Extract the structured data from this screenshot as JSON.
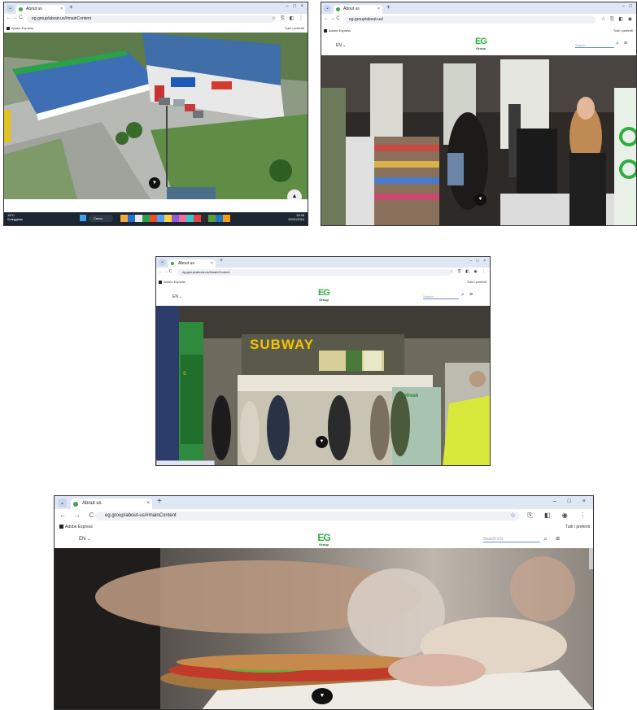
{
  "screenshots": [
    {
      "tab_title": "About us",
      "url": "eg.group/about-us/#mainContent",
      "bookmark": "Adobe Express",
      "bookmarks_right": "Tutti i preferiti"
    },
    {
      "tab_title": "About us",
      "url": "eg.group/about-us/",
      "bookmark": "Adobe Express",
      "bookmarks_right": "Tutti i preferiti",
      "lang": "EN",
      "logo_top": "EG",
      "logo_bottom": "Group",
      "search_placeholder": "Search"
    },
    {
      "tab_title": "About us",
      "url": "eg.group/about-us/#mainContent",
      "bookmark": "Adobe Express",
      "bookmarks_right": "Tutti i preferiti",
      "lang": "EN",
      "logo_top": "EG",
      "logo_bottom": "Group",
      "search_placeholder": "Search",
      "sign_text": "SUBWAY",
      "sign_text_2": "Refresh"
    },
    {
      "tab_title": "About us",
      "url": "eg.group/about-us/#mainContent",
      "bookmark": "Adobe Express",
      "bookmarks_right": "Tutti i preferiti",
      "lang": "EN",
      "logo_top": "EG",
      "logo_bottom": "Group",
      "search_placeholder": "Search EG"
    }
  ],
  "taskbar": {
    "weather_temp": "15°C",
    "weather_desc": "Soleggiato",
    "search_label": "Cerca",
    "time": "15:35",
    "date": "20/11/2024"
  },
  "icons": [
    "down-arrow-icon",
    "search-icon",
    "hamburger-icon",
    "star-icon",
    "extensions-icon",
    "profile-icon",
    "back-icon",
    "forward-icon",
    "reload-icon",
    "close-icon",
    "windows-start-icon"
  ],
  "colors": {
    "eg_green": "#2fae3f",
    "tabbar": "#dfe7f5",
    "subway_yellow": "#f5c400"
  }
}
